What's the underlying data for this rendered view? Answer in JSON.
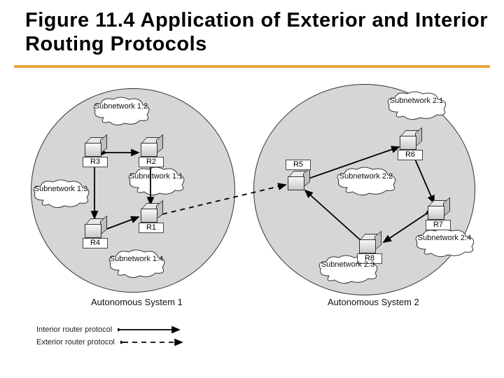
{
  "title": "Figure 11.4 Application of Exterior and Interior Routing Protocols",
  "as": {
    "sys1": "Autonomous System 1",
    "sys2": "Autonomous System 2"
  },
  "subnets": {
    "s12": "Subnetwork\n1.2",
    "s13": "Subnetwork\n1.3",
    "s11": "Subnetwork\n1.1",
    "s14": "Subnetwork\n1.4",
    "s21": "Subnetwork\n2.1",
    "s22": "Subnetwork\n2.2",
    "s23": "Subnetwork\n2.3",
    "s24": "Subnetwork\n2.4"
  },
  "routers": {
    "r1": "R1",
    "r2": "R2",
    "r3": "R3",
    "r4": "R4",
    "r5": "R5",
    "r6": "R6",
    "r7": "R7",
    "r8": "R8"
  },
  "legend": {
    "interior": "Interior router protocol",
    "exterior": "Exterior router protocol"
  }
}
